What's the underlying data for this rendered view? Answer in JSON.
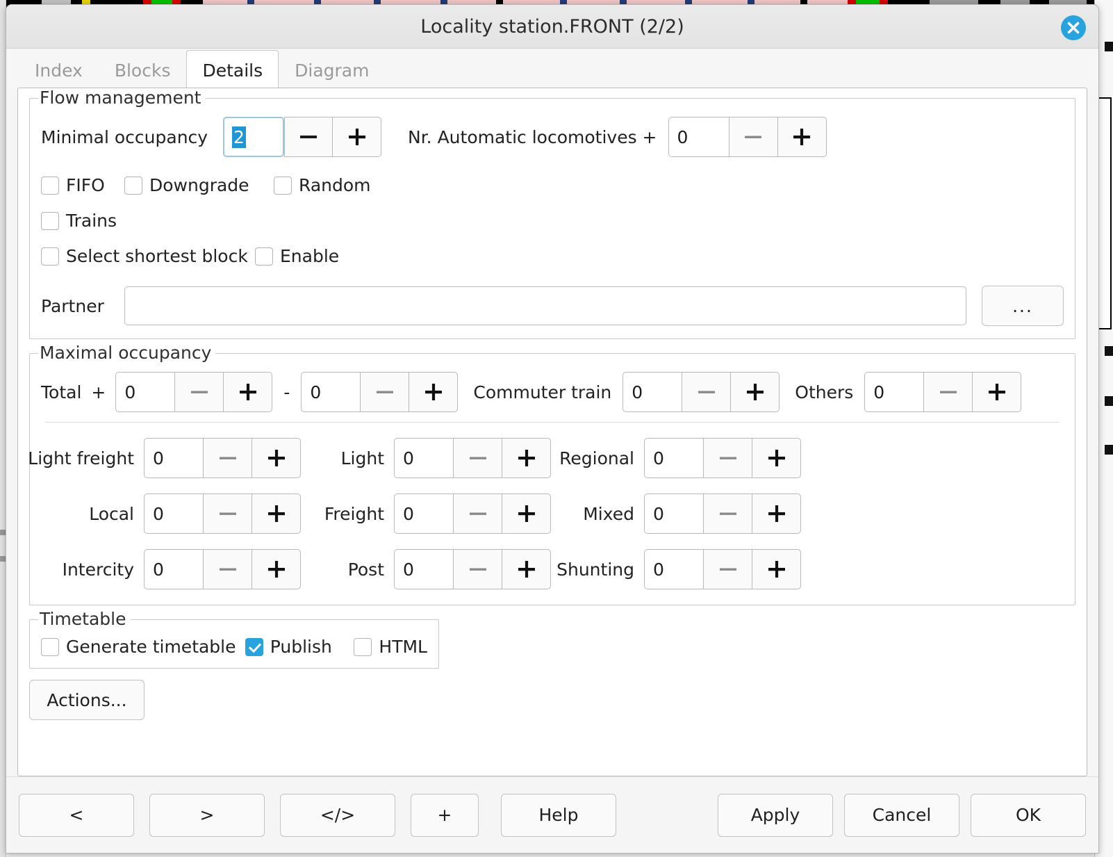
{
  "window": {
    "title": "Locality station.FRONT (2/2)",
    "close_icon": "close-circle-icon"
  },
  "tabs": [
    {
      "label": "Index",
      "active": false
    },
    {
      "label": "Blocks",
      "active": false
    },
    {
      "label": "Details",
      "active": true
    },
    {
      "label": "Diagram",
      "active": false
    }
  ],
  "flow_management": {
    "legend": "Flow management",
    "minimal_occupancy": {
      "label": "Minimal occupancy",
      "value": "2",
      "selected": true,
      "minus": "—",
      "plus": "+"
    },
    "automatic_locomotives": {
      "label": "Nr. Automatic locomotives +",
      "value": "0",
      "minus": "—",
      "plus": "+"
    },
    "checkboxes": [
      {
        "label": "FIFO",
        "checked": false
      },
      {
        "label": "Downgrade",
        "checked": false
      },
      {
        "label": "Random",
        "checked": false
      },
      {
        "label": "Trains",
        "checked": false
      },
      {
        "label": "Select shortest block",
        "checked": false
      },
      {
        "label": "Enable",
        "checked": false
      }
    ],
    "partner": {
      "label": "Partner",
      "value": "",
      "placeholder": "",
      "browse_label": "..."
    }
  },
  "maximal_occupancy": {
    "legend": "Maximal occupancy",
    "total_label": "Total",
    "total_plus_sign": "+",
    "range_separator": "-",
    "total_from": "0",
    "total_to": "0",
    "commuter_train_label": "Commuter train",
    "commuter_train_value": "0",
    "others_label": "Others",
    "others_value": "0",
    "grid": [
      {
        "label": "Light freight",
        "value": "0"
      },
      {
        "label": "Light",
        "value": "0"
      },
      {
        "label": "Regional",
        "value": "0"
      },
      {
        "label": "Local",
        "value": "0"
      },
      {
        "label": "Freight",
        "value": "0"
      },
      {
        "label": "Mixed",
        "value": "0"
      },
      {
        "label": "Intercity",
        "value": "0"
      },
      {
        "label": "Post",
        "value": "0"
      },
      {
        "label": "Shunting",
        "value": "0"
      }
    ]
  },
  "timetable": {
    "legend": "Timetable",
    "checkboxes": [
      {
        "label": "Generate timetable",
        "checked": false
      },
      {
        "label": "Publish",
        "checked": true
      },
      {
        "label": "HTML",
        "checked": false
      }
    ]
  },
  "actions_button": "Actions...",
  "footer": {
    "prev": "<",
    "next": ">",
    "code": "</>",
    "add": "+",
    "help": "Help",
    "apply": "Apply",
    "cancel": "Cancel",
    "ok": "OK"
  },
  "colors": {
    "accent": "#29a3dd",
    "selection": "#2196d4",
    "window_bg": "#f5f5f5",
    "content_bg": "#ffffff",
    "border": "#c9c9c9",
    "text": "#222222",
    "muted_text": "#9a9a9a"
  }
}
